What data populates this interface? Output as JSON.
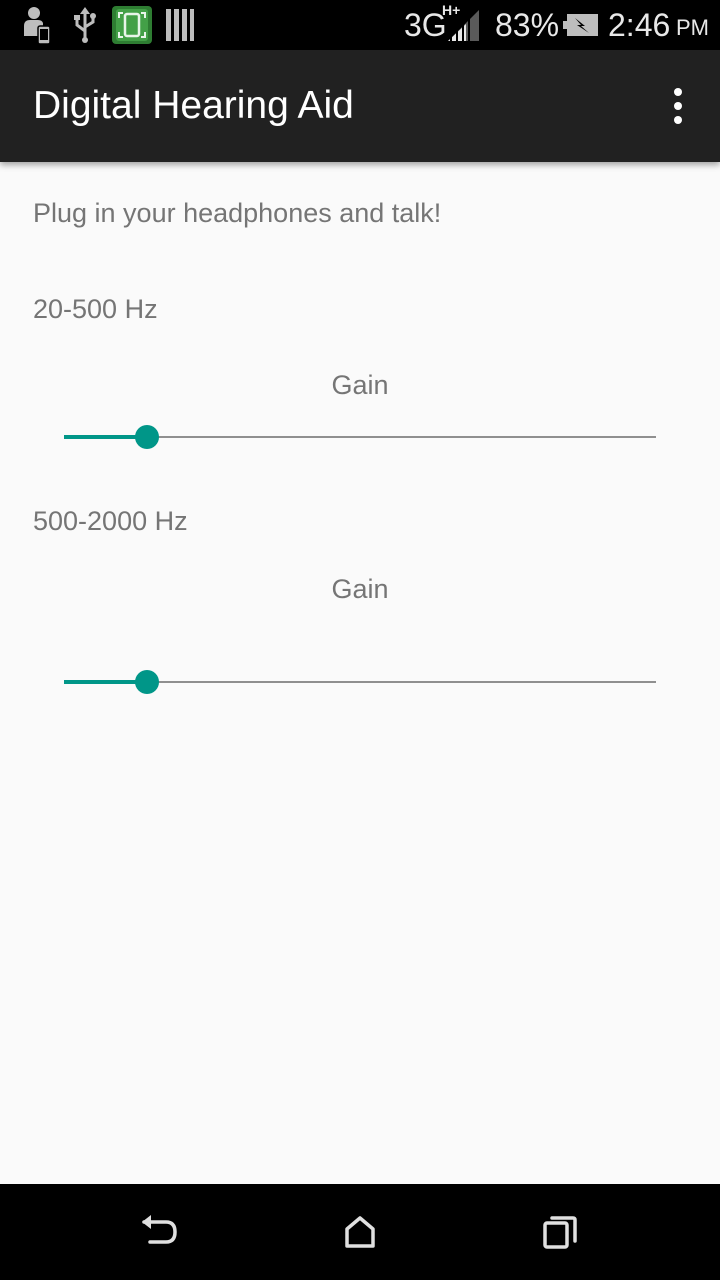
{
  "status_bar": {
    "icons_left": [
      "person-phone-icon",
      "usb-icon",
      "screenshot-app-icon",
      "barcode-icon"
    ],
    "network": "3G",
    "network_sub": "H+",
    "battery_percent": "83%",
    "time": "2:46",
    "ampm": "PM"
  },
  "app_bar": {
    "title": "Digital Hearing Aid",
    "menu_icon": "overflow-menu-icon"
  },
  "main": {
    "instruction": "Plug in your headphones and talk!",
    "bands": [
      {
        "label": "20-500 Hz",
        "gain_label": "Gain",
        "value": 0.14
      },
      {
        "label": "500-2000 Hz",
        "gain_label": "Gain",
        "value": 0.14
      }
    ]
  },
  "nav_bar": {
    "icons": [
      "back-icon",
      "home-icon",
      "recents-icon"
    ]
  },
  "colors": {
    "accent": "#009688",
    "app_bar": "#212121",
    "background": "#fafafa",
    "text_secondary": "#757575"
  }
}
